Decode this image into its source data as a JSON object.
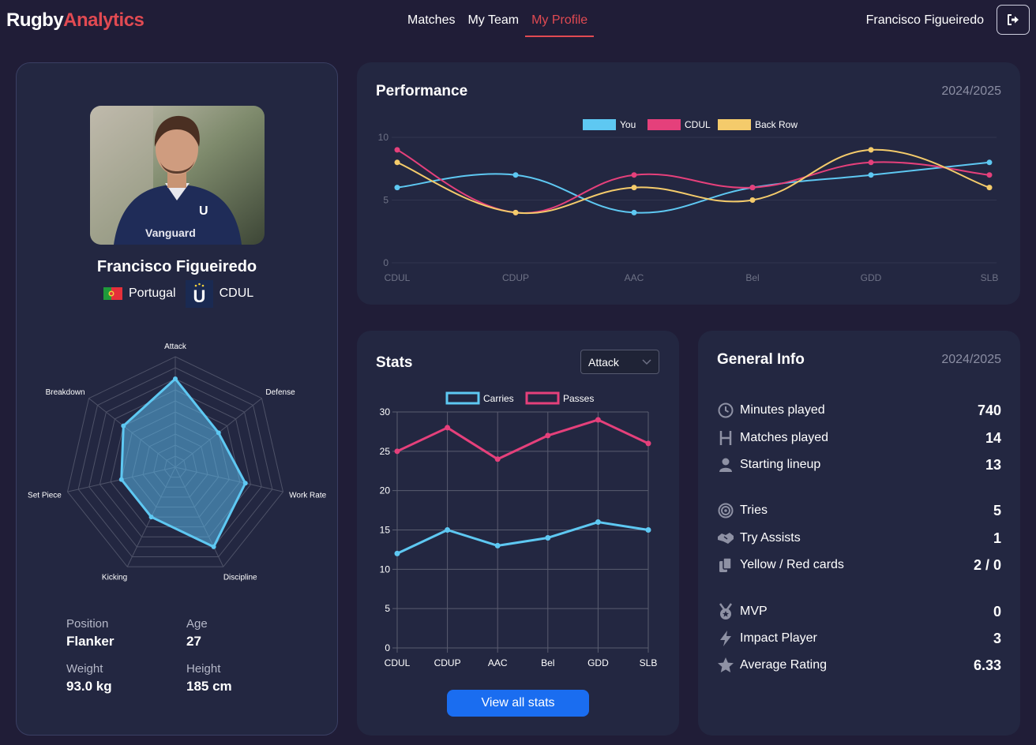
{
  "brand": {
    "part1": "Rugby",
    "part2": "Analytics"
  },
  "nav": {
    "items": [
      "Matches",
      "My Team",
      "My Profile"
    ],
    "active": "My Profile"
  },
  "user": {
    "name": "Francisco Figueiredo",
    "logout_icon": "logout-icon"
  },
  "colors": {
    "accent": "#e14a52",
    "you": "#5ec8f2",
    "club": "#e5407b",
    "backrow": "#f4cb6b",
    "primary_button": "#1a6df0"
  },
  "profile": {
    "name": "Francisco Figueiredo",
    "nationality": "Portugal",
    "club": "CDUL",
    "radar": {
      "axes": [
        "Attack",
        "Defense",
        "Work Rate",
        "Discipline",
        "Kicking",
        "Set Piece",
        "Breakdown"
      ],
      "max": 10,
      "values": [
        8,
        5,
        6.5,
        8,
        5,
        5,
        6
      ]
    },
    "attributes": {
      "position_label": "Position",
      "position": "Flanker",
      "age_label": "Age",
      "age": "27",
      "weight_label": "Weight",
      "weight": "93.0 kg",
      "height_label": "Height",
      "height": "185 cm"
    }
  },
  "performance": {
    "title": "Performance",
    "season": "2024/2025",
    "chart_data": {
      "type": "line",
      "categories": [
        "CDUL",
        "CDUP",
        "AAC",
        "Bel",
        "GDD",
        "SLB"
      ],
      "series": [
        {
          "name": "You",
          "values": [
            6,
            7,
            4,
            6,
            7,
            8
          ]
        },
        {
          "name": "CDUL",
          "values": [
            9,
            4,
            7,
            6,
            8,
            7
          ]
        },
        {
          "name": "Back Row",
          "values": [
            8,
            4,
            6,
            5,
            9,
            6
          ]
        }
      ],
      "ylim": [
        0,
        10
      ],
      "yticks": [
        0,
        5,
        10
      ],
      "legend": "top-center"
    }
  },
  "stats": {
    "title": "Stats",
    "select_value": "Attack",
    "button_label": "View all stats",
    "chart_data": {
      "type": "line",
      "categories": [
        "CDUL",
        "CDUP",
        "AAC",
        "Bel",
        "GDD",
        "SLB"
      ],
      "series": [
        {
          "name": "Carries",
          "values": [
            12,
            15,
            13,
            14,
            16,
            15
          ]
        },
        {
          "name": "Passes",
          "values": [
            25,
            28,
            24,
            27,
            29,
            26
          ]
        }
      ],
      "ylim": [
        0,
        30
      ],
      "yticks": [
        0,
        5,
        10,
        15,
        20,
        25,
        30
      ],
      "grid": true,
      "legend": "top-center"
    }
  },
  "general": {
    "title": "General Info",
    "season": "2024/2025",
    "rows": [
      {
        "icon": "clock-icon",
        "label": "Minutes played",
        "value": "740"
      },
      {
        "icon": "rugby-posts-icon",
        "label": "Matches played",
        "value": "14"
      },
      {
        "icon": "person-icon",
        "label": "Starting lineup",
        "value": "13"
      },
      {
        "icon": "target-icon",
        "label": "Tries",
        "value": "5"
      },
      {
        "icon": "handshake-icon",
        "label": "Try Assists",
        "value": "1"
      },
      {
        "icon": "cards-icon",
        "label": "Yellow / Red cards",
        "value": "2 / 0"
      },
      {
        "icon": "medal-icon",
        "label": "MVP",
        "value": "0"
      },
      {
        "icon": "bolt-icon",
        "label": "Impact Player",
        "value": "3"
      },
      {
        "icon": "star-icon",
        "label": "Average Rating",
        "value": "6.33"
      }
    ]
  }
}
